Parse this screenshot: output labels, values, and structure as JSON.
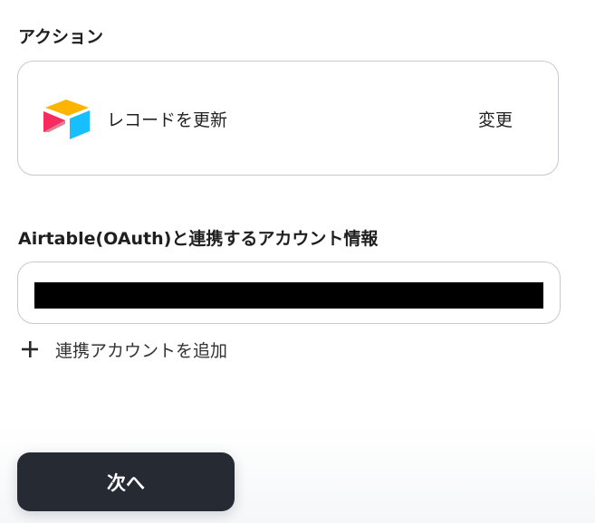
{
  "action_section": {
    "label": "アクション",
    "app_icon": "airtable-icon",
    "action_name": "レコードを更新",
    "change_label": "変更"
  },
  "account_section": {
    "label": "Airtable(OAuth)と連携するアカウント情報",
    "selected_value": "",
    "add_account_label": "連携アカウントを追加",
    "add_icon": "plus-icon"
  },
  "footer": {
    "next_label": "次へ"
  },
  "colors": {
    "button_bg": "#262a33",
    "border": "#c9c9cf",
    "airtable_yellow": "#FCB400",
    "airtable_blue": "#18BFFF",
    "airtable_red": "#F82B60"
  }
}
